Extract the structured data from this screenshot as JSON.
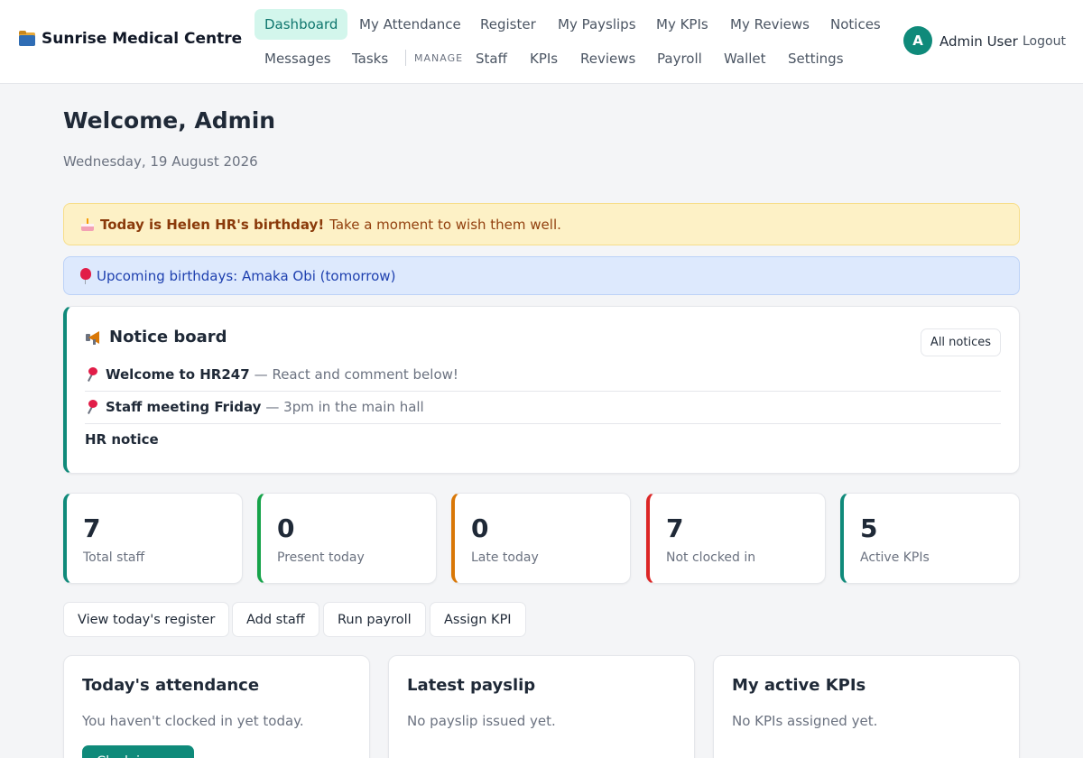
{
  "header": {
    "brand": "Sunrise Medical Centre",
    "brand_icon": "card-index-dividers-icon",
    "nav": [
      {
        "label": "Dashboard",
        "active": true
      },
      {
        "label": "My Attendance"
      },
      {
        "label": "Register"
      },
      {
        "label": "My Payslips"
      },
      {
        "label": "My KPIs"
      },
      {
        "label": "My Reviews"
      },
      {
        "label": "Notices"
      },
      {
        "label": "Messages"
      },
      {
        "label": "Tasks"
      }
    ],
    "manage_label": "MANAGE",
    "manage_nav": [
      {
        "label": "Staff"
      },
      {
        "label": "KPIs"
      },
      {
        "label": "Reviews"
      },
      {
        "label": "Payroll"
      },
      {
        "label": "Wallet"
      },
      {
        "label": "Settings"
      }
    ],
    "user": {
      "initial": "A",
      "name": "Admin User"
    },
    "logout_label": "Logout"
  },
  "main": {
    "welcome": "Welcome, Admin",
    "date": "Wednesday, 19 August 2026",
    "birthday_banner": {
      "bold": "Today is Helen HR's birthday!",
      "text": "Take a moment to wish them well."
    },
    "upcoming_banner": "Upcoming birthdays: Amaka Obi (tomorrow)",
    "notice_board": {
      "title": "Notice board",
      "all_label": "All notices",
      "items": [
        {
          "title": "Welcome to HR247",
          "text": "— React and comment below!",
          "pinned": true
        },
        {
          "title": "Staff meeting Friday",
          "text": "— 3pm in the main hall",
          "pinned": true
        },
        {
          "title": "HR notice",
          "text": "",
          "pinned": false
        }
      ]
    },
    "stats": [
      {
        "value": "7",
        "label": "Total staff",
        "color": "#0f8a7a"
      },
      {
        "value": "0",
        "label": "Present today",
        "color": "#16a34a"
      },
      {
        "value": "0",
        "label": "Late today",
        "color": "#d97706"
      },
      {
        "value": "7",
        "label": "Not clocked in",
        "color": "#dc2626"
      },
      {
        "value": "5",
        "label": "Active KPIs",
        "color": "#0f8a7a"
      }
    ],
    "actions": [
      {
        "label": "View today's register"
      },
      {
        "label": "Add staff"
      },
      {
        "label": "Run payroll"
      },
      {
        "label": "Assign KPI"
      }
    ],
    "cards": {
      "attendance": {
        "title": "Today's attendance",
        "text": "You haven't clocked in yet today.",
        "button": "Clock in now"
      },
      "payslip": {
        "title": "Latest payslip",
        "text": "No payslip issued yet."
      },
      "kpis": {
        "title": "My active KPIs",
        "text": "No KPIs assigned yet."
      }
    }
  },
  "colors": {
    "accent": "#0f8a7a",
    "accent_light": "#d3f6ec"
  }
}
